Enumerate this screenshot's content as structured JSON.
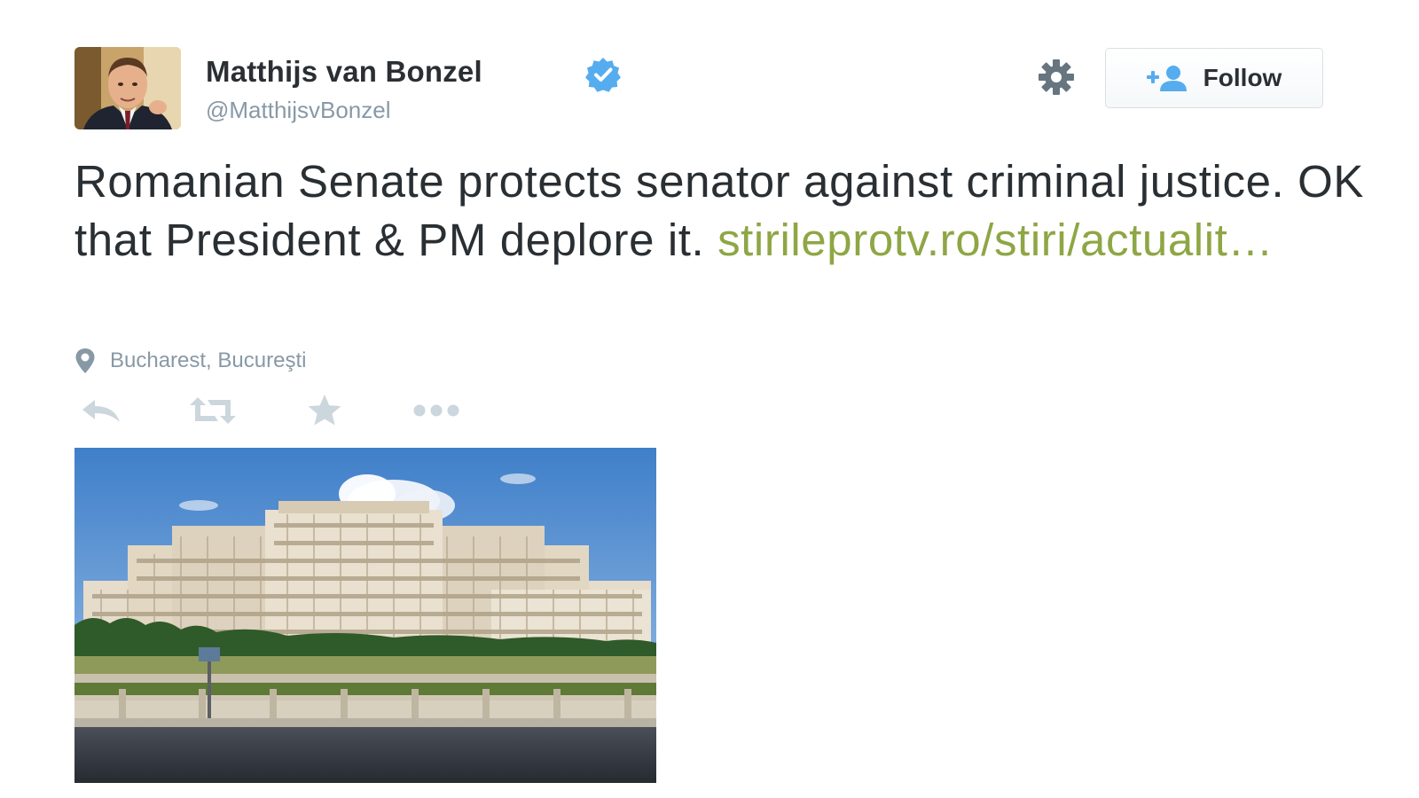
{
  "user": {
    "display_name": "Matthijs van Bonzel",
    "screen_name": "@MatthijsvBonzel",
    "verified": true,
    "avatar_icon": "profile-photo"
  },
  "header": {
    "settings_icon": "gear-icon",
    "follow_label": "Follow",
    "follow_icon": "add-person-icon"
  },
  "tweet": {
    "text_prefix": "Romanian Senate protects senator against criminal justice. OK that President & PM deplore it. ",
    "link_text": "stirileprotv.ro/stiri/actualit…",
    "link_color": "#8ea644"
  },
  "location": {
    "label": "Bucharest, Bucureşti",
    "icon": "location-pin-icon"
  },
  "actions": [
    {
      "name": "reply",
      "icon": "reply-icon"
    },
    {
      "name": "retweet",
      "icon": "retweet-icon"
    },
    {
      "name": "favorite",
      "icon": "star-icon"
    },
    {
      "name": "more",
      "icon": "more-icon"
    }
  ],
  "media": {
    "icon": "palace-of-parliament-photo"
  },
  "colors": {
    "text": "#292f33",
    "muted": "#8899a6",
    "action_icon": "#ccd6dd",
    "verified": "#55acee",
    "link": "#8ea644"
  }
}
